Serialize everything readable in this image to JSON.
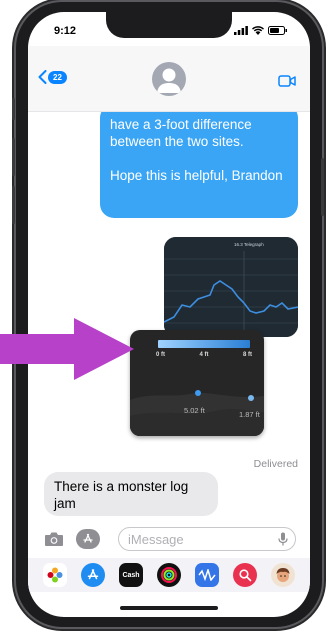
{
  "status_bar": {
    "time": "9:12"
  },
  "header": {
    "back_count": "22",
    "back_icon": "chevron-left-icon",
    "avatar_icon": "person-silhouette-icon",
    "video_icon": "video-camera-icon"
  },
  "messages": {
    "outgoing_text": [
      "have a 3-foot difference between the two sites.",
      "Hope this is helpful, Brandon"
    ],
    "graph_image": {
      "title": "16.3 Telegraph",
      "description": "water-level line graph screenshot"
    },
    "gauge_image": {
      "ticks": [
        "0 ft",
        "4 ft",
        "8 ft"
      ],
      "value_left": "5.02 ft",
      "value_right": "1.87 ft"
    },
    "status": "Delivered",
    "incoming_text": "There is a monster log jam"
  },
  "composer": {
    "placeholder": "iMessage",
    "camera_icon": "camera-icon",
    "apps_icon": "app-store-icon",
    "mic_icon": "microphone-icon"
  },
  "app_drawer": {
    "apps": [
      "photos",
      "app-store",
      "Cash",
      "fitness",
      "music",
      "images-search",
      "memoji"
    ]
  },
  "colors": {
    "accent_blue": "#3aa5f5",
    "incoming_bubble": "#e9e9eb",
    "arrow": "#b742c9"
  }
}
